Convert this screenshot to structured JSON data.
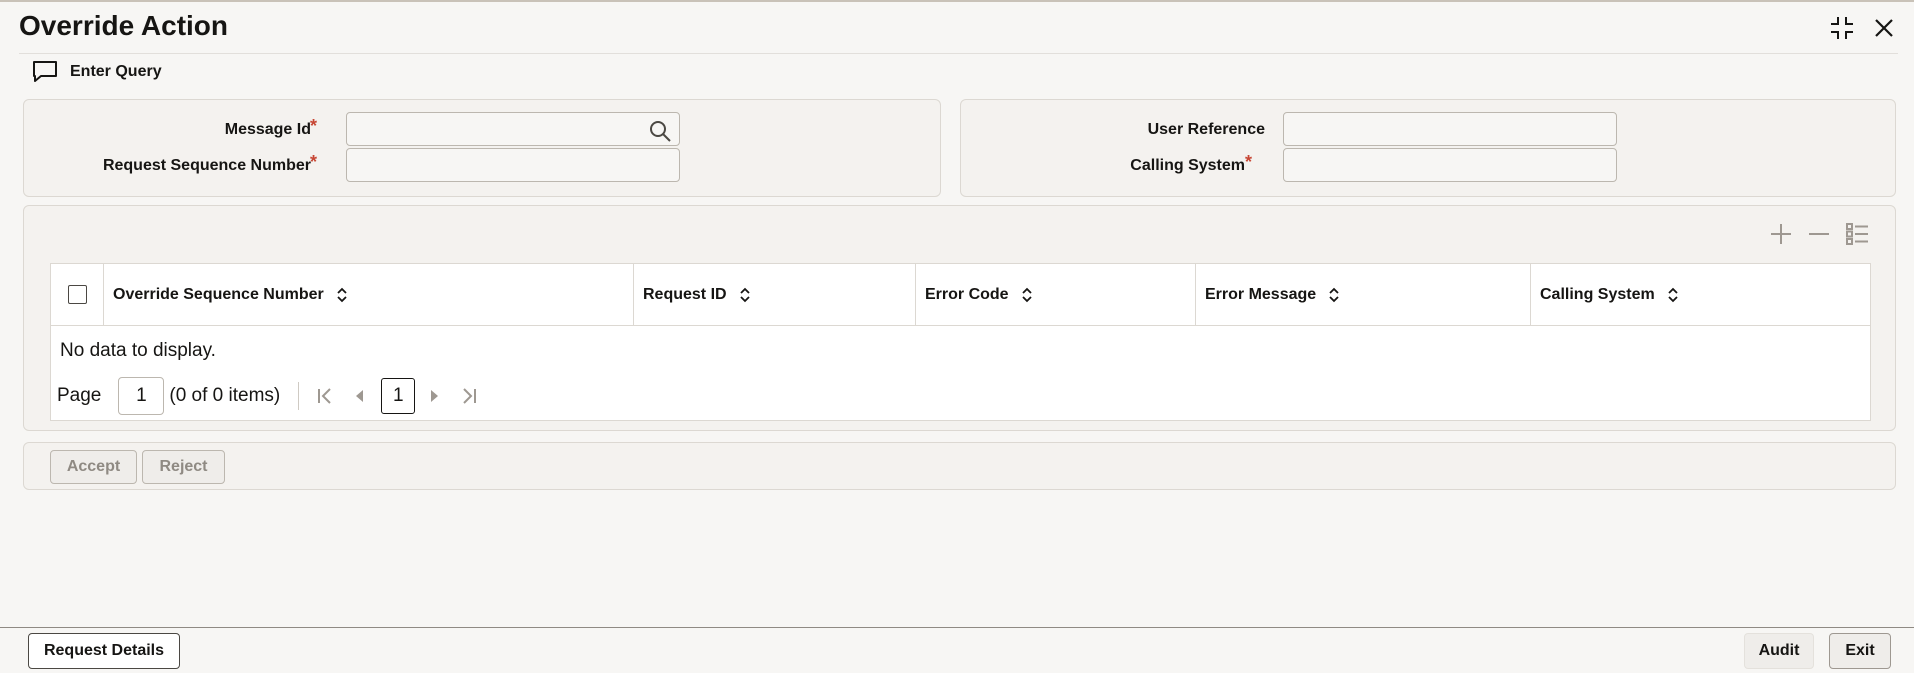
{
  "title": "Override Action",
  "toolbar": {
    "enter_query": "Enter Query"
  },
  "form": {
    "message_id_label": "Message Id",
    "request_seq_label": "Request Sequence Number",
    "user_reference_label": "User Reference",
    "calling_system_label": "Calling System",
    "required_mark": "*",
    "message_id_value": "",
    "request_seq_value": "",
    "user_reference_value": "",
    "calling_system_value": ""
  },
  "table": {
    "columns": [
      "Override Sequence Number",
      "Request ID",
      "Error Code",
      "Error Message",
      "Calling System"
    ],
    "empty_text": "No data to display.",
    "rows": []
  },
  "pager": {
    "page_label": "Page",
    "page_value": "1",
    "items_text": "(0 of 0 items)",
    "current_page": "1"
  },
  "actions": {
    "accept": "Accept",
    "reject": "Reject"
  },
  "footer": {
    "request_details": "Request Details",
    "audit": "Audit",
    "exit": "Exit"
  },
  "icons": {
    "minimize": "minimize-icon",
    "close": "close-icon",
    "enter_query": "chat-bubble-icon",
    "search": "search-icon",
    "add_row": "plus-icon",
    "delete_row": "minus-icon",
    "single_record": "list-view-icon",
    "sort": "sort-icon"
  },
  "colors": {
    "required": "#c74634",
    "text": "#161513",
    "background": "#f7f6f4"
  }
}
